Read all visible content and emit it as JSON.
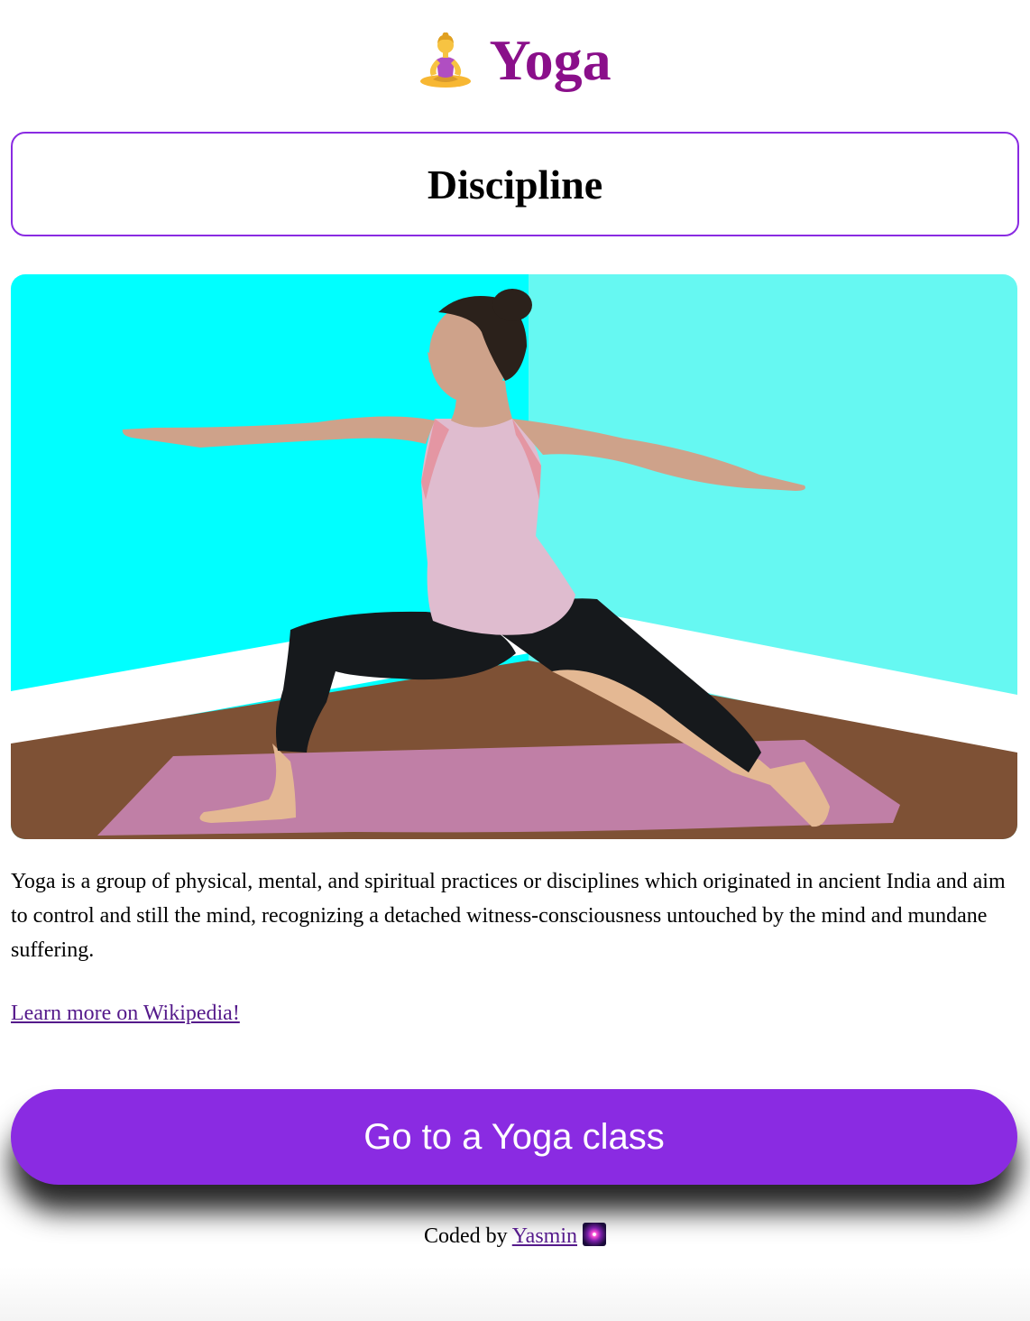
{
  "header": {
    "title": "Yoga",
    "icon": "person-in-lotus-position-icon"
  },
  "card": {
    "title": "Discipline"
  },
  "hero": {
    "icon": "warrior-pose-illustration"
  },
  "description": "Yoga is a group of physical, mental, and spiritual practices or disciplines which originated in ancient India and aim to control and still the mind, recognizing a detached witness-consciousness untouched by the mind and mundane suffering.",
  "link": {
    "label": "Learn more on Wikipedia!"
  },
  "cta": {
    "label": "Go to a Yoga class"
  },
  "footer": {
    "prefix": "Coded by",
    "author": "Yasmin",
    "icon": "sparkle-icon"
  },
  "colors": {
    "title": "#8a0f8a",
    "accent": "#8a2be2",
    "link": "#551a8b",
    "wall_left": "#00ffff",
    "wall_right": "#66f8f2",
    "floor": "#7e5135",
    "mat": "#c07fa6"
  }
}
